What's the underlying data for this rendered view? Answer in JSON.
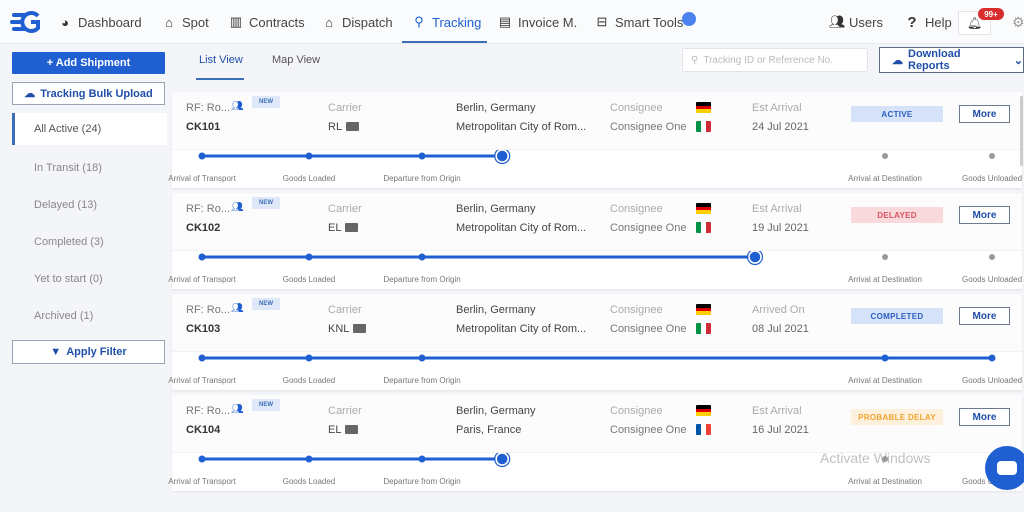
{
  "topbar": {
    "logo_icon": "logo-icon",
    "nav": [
      {
        "label": "Dashboard",
        "icon": "pie-chart-icon",
        "active": false
      },
      {
        "label": "Spot",
        "icon": "home-icon",
        "active": false
      },
      {
        "label": "Contracts",
        "icon": "briefcase-icon",
        "active": false
      },
      {
        "label": "Dispatch",
        "icon": "home-icon",
        "active": false
      },
      {
        "label": "Tracking",
        "icon": "map-pin-icon",
        "active": true
      },
      {
        "label": "Invoice M.",
        "icon": "document-icon",
        "active": false
      },
      {
        "label": "Smart Tools",
        "icon": "toolbox-icon",
        "active": false
      }
    ],
    "right": [
      {
        "label": "Users",
        "icon": "users-icon"
      },
      {
        "label": "Help",
        "icon": "question-icon"
      }
    ],
    "notification_badge": "99+",
    "accent_color": "#1f5fd1"
  },
  "sidebar": {
    "add_shipment": "+ Add Shipment",
    "bulk_upload": "Tracking Bulk Upload",
    "filters": [
      {
        "label": "All Active (24)",
        "active": true
      },
      {
        "label": "In Transit (18)",
        "active": false
      },
      {
        "label": "Delayed (13)",
        "active": false
      },
      {
        "label": "Completed (3)",
        "active": false
      },
      {
        "label": "Yet to start (0)",
        "active": false
      },
      {
        "label": "Archived (1)",
        "active": false
      }
    ],
    "apply_filter": "Apply Filter"
  },
  "toolbar": {
    "tabs": [
      {
        "label": "List View",
        "active": true
      },
      {
        "label": "Map View",
        "active": false
      }
    ],
    "search_placeholder": "Tracking ID or Reference No.",
    "download_reports": "Download Reports"
  },
  "stages": [
    "Arrival of Transport",
    "Goods Loaded",
    "Departure from Origin",
    "Arrival at Destination",
    "Goods Unloaded"
  ],
  "shipments": [
    {
      "ref": "RF: Ro...",
      "badge": "NEW",
      "id": "CK101",
      "carrier_label": "Carrier",
      "carrier": "RL",
      "origin": "Berlin, Germany",
      "origin_flag": "DE",
      "destination": "Metropolitan City of Rom...",
      "destination_flag": "IT",
      "consignee_label": "Consignee",
      "consignee": "Consignee One",
      "date_label": "Est Arrival",
      "date": "24 Jul 2021",
      "status": "ACTIVE",
      "status_bg": "#d6e2f7",
      "status_fg": "#2b5fc4",
      "more": "More",
      "progress_stage": 3,
      "progress_fraction": 0.38
    },
    {
      "ref": "RF: Ro...",
      "badge": "NEW",
      "id": "CK102",
      "carrier_label": "Carrier",
      "carrier": "EL",
      "origin": "Berlin, Germany",
      "origin_flag": "DE",
      "destination": "Metropolitan City of Rom...",
      "destination_flag": "IT",
      "consignee_label": "Consignee",
      "consignee": "Consignee One",
      "date_label": "Est Arrival",
      "date": "19 Jul 2021",
      "status": "DELAYED",
      "status_bg": "#f9dadc",
      "status_fg": "#d9535f",
      "more": "More",
      "progress_stage": 3,
      "progress_fraction": 0.7
    },
    {
      "ref": "RF: Ro...",
      "badge": "NEW",
      "id": "CK103",
      "carrier_label": "Carrier",
      "carrier": "KNL",
      "origin": "Berlin, Germany",
      "origin_flag": "DE",
      "destination": "Metropolitan City of Rom...",
      "destination_flag": "IT",
      "consignee_label": "Consignee",
      "consignee": "Consignee One",
      "date_label": "Arrived On",
      "date": "08 Jul 2021",
      "status": "COMPLETED",
      "status_bg": "#d6e2f7",
      "status_fg": "#2b5fc4",
      "more": "More",
      "progress_stage": 5,
      "progress_fraction": 1.0
    },
    {
      "ref": "RF: Ro...",
      "badge": "NEW",
      "id": "CK104",
      "carrier_label": "Carrier",
      "carrier": "EL",
      "origin": "Berlin, Germany",
      "origin_flag": "DE",
      "destination": "Paris, France",
      "destination_flag": "FR",
      "consignee_label": "Consignee",
      "consignee": "Consignee One",
      "date_label": "Est Arrival",
      "date": "16 Jul 2021",
      "status": "PROBABLE DELAY",
      "status_bg": "#fdf0dc",
      "status_fg": "#f0a531",
      "more": "More",
      "progress_stage": 3,
      "progress_fraction": 0.38
    }
  ],
  "watermark": {
    "line1": "Activate Windows"
  }
}
